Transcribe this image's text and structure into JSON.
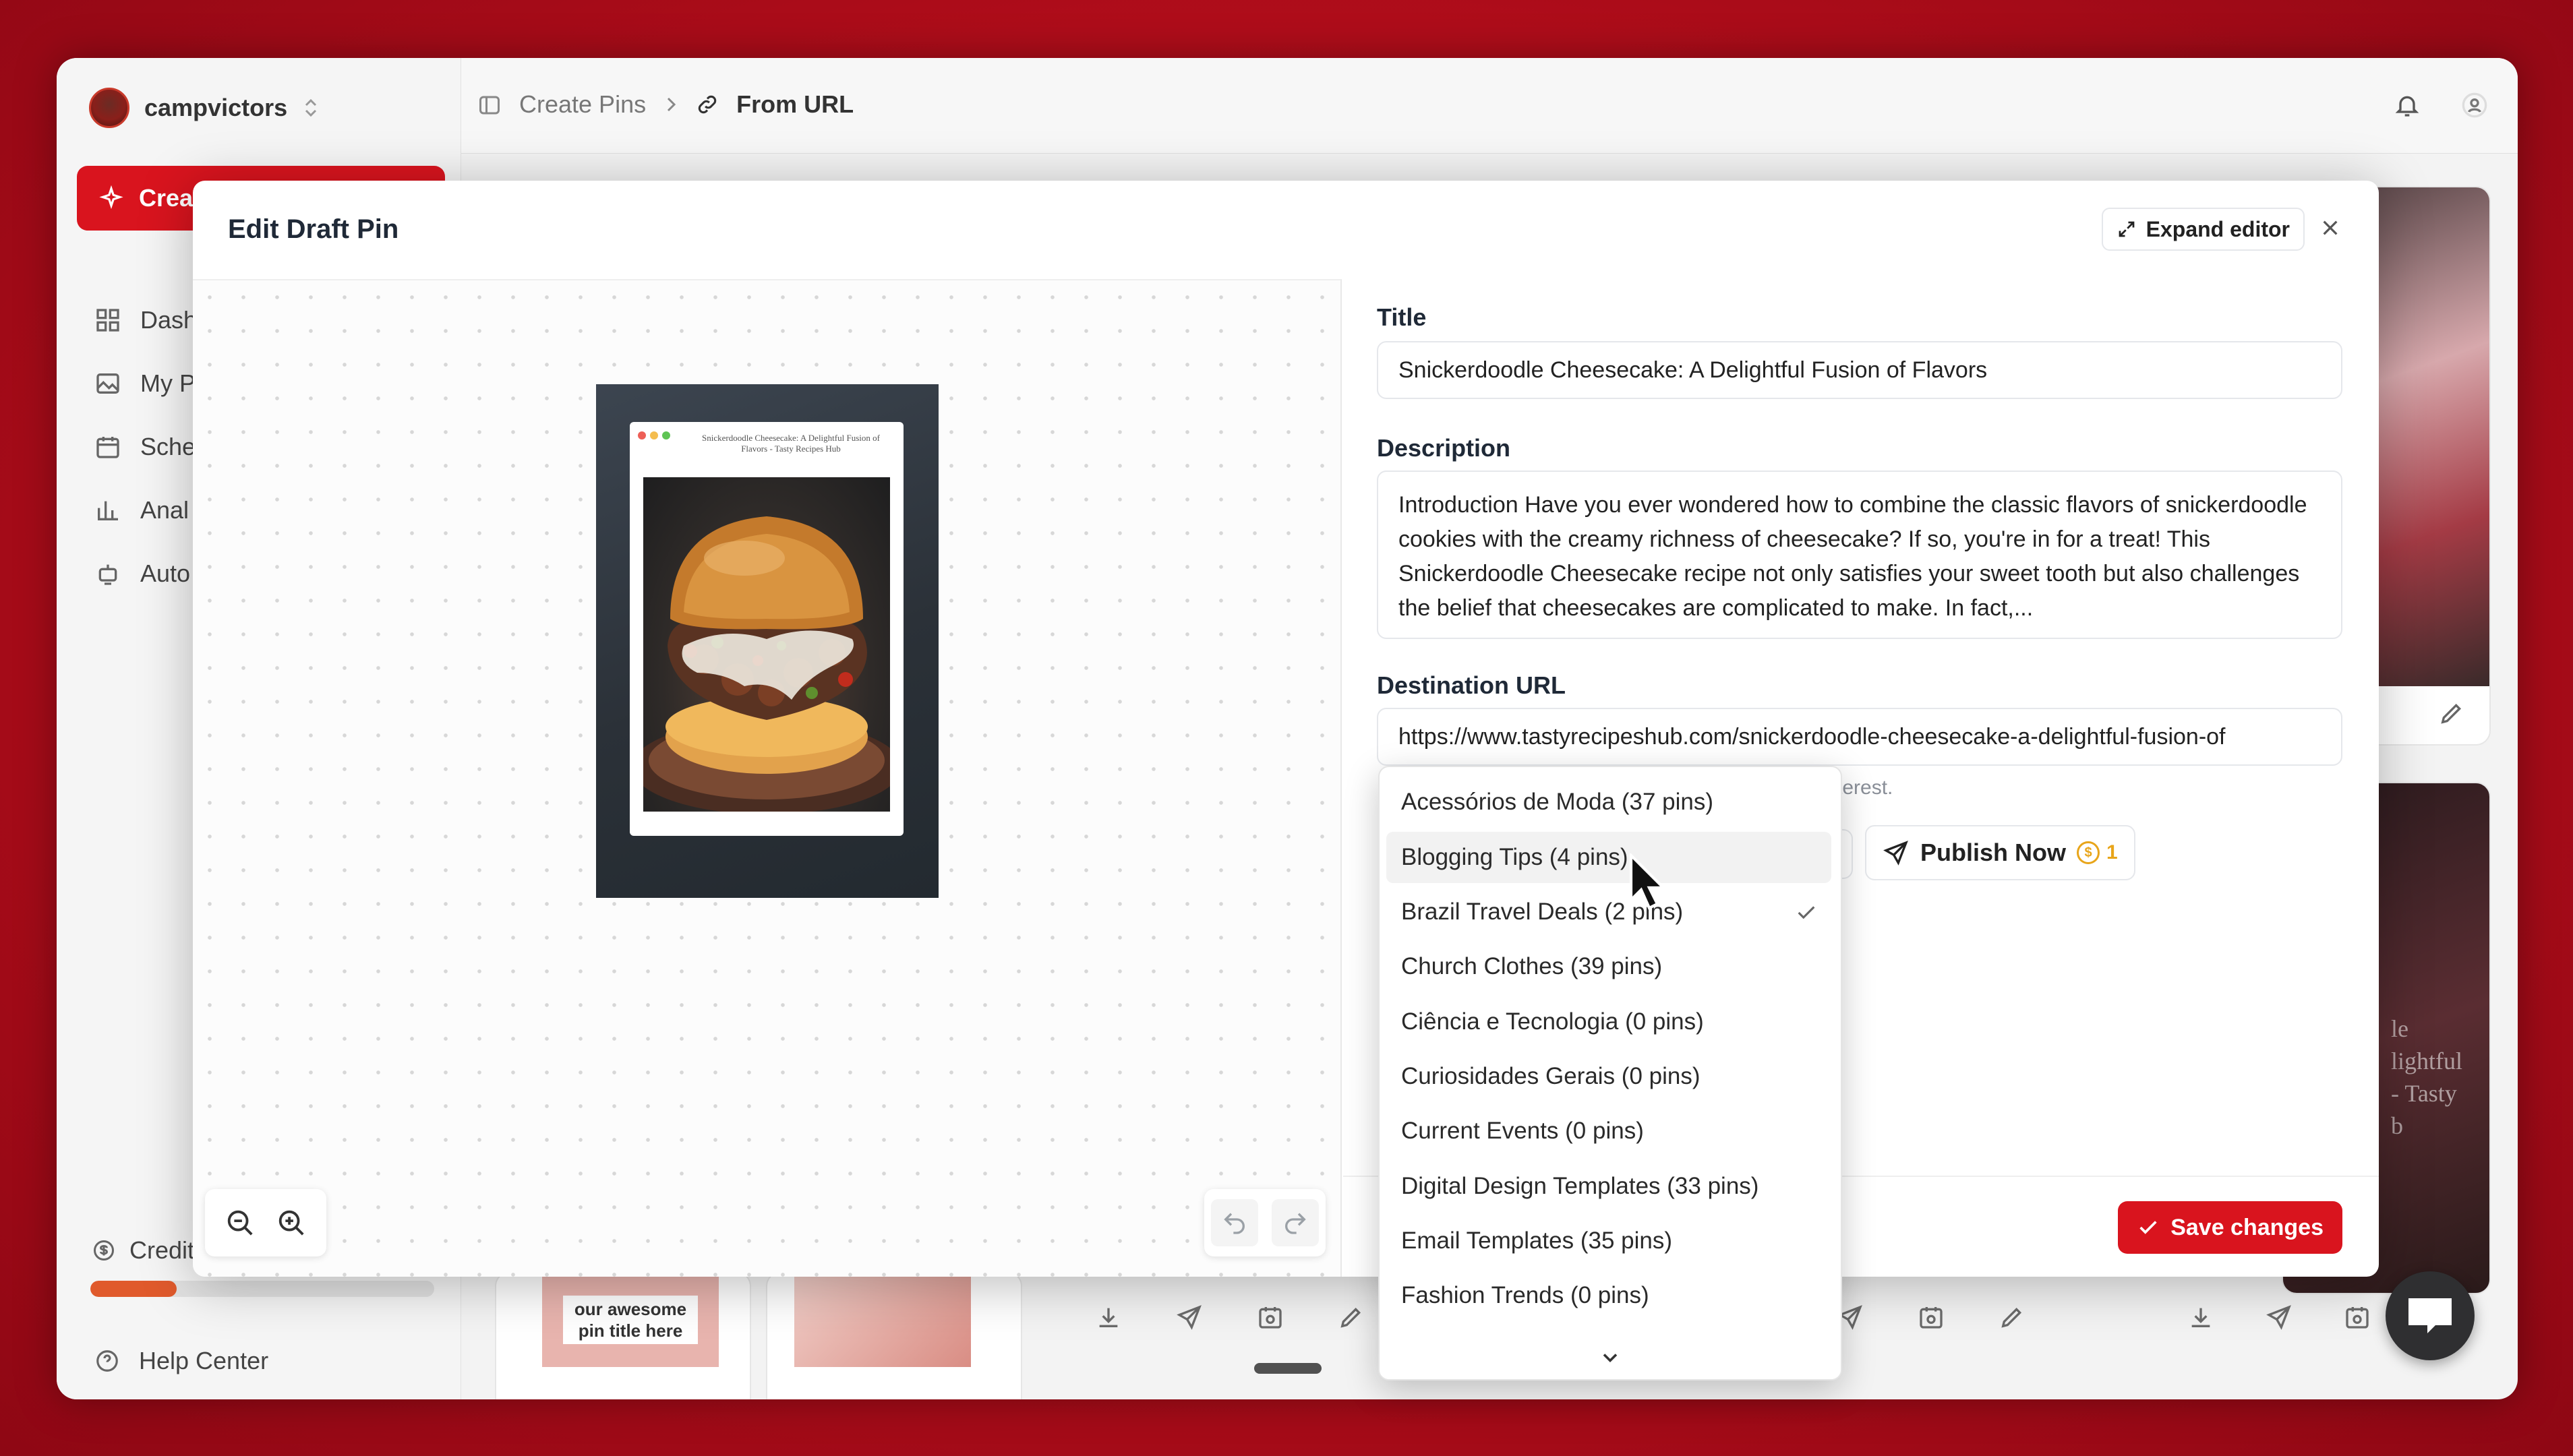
{
  "account": {
    "name": "campvictors"
  },
  "sidebar": {
    "create_label": "Crea",
    "items": [
      {
        "label": "Dash",
        "icon": "dashboard-icon"
      },
      {
        "label": "My P",
        "icon": "image-icon"
      },
      {
        "label": "Sche",
        "icon": "calendar-icon"
      },
      {
        "label": "Anal",
        "icon": "chart-icon"
      },
      {
        "label": "Auto",
        "icon": "robot-icon"
      }
    ],
    "credits_label": "Credit",
    "credits_progress": 0.25,
    "help_label": "Help Center"
  },
  "breadcrumb": {
    "parent": "Create Pins",
    "current": "From URL"
  },
  "background_cards": {
    "thumb_text": "our awesome pin title here",
    "overlay_text": [
      "le",
      "lightful",
      "- Tasty",
      "b"
    ]
  },
  "modal": {
    "title": "Edit Draft Pin",
    "expand_label": "Expand editor",
    "pin_preview": {
      "header_text": "Snickerdoodle Cheesecake: A Delightful Fusion of Flavors - Tasty Recipes Hub"
    },
    "form": {
      "title_label": "Title",
      "title_value": "Snickerdoodle Cheesecake: A Delightful Fusion of Flavors",
      "description_label": "Description",
      "description_value": "Introduction Have you ever wondered how to combine the classic flavors of snickerdoodle cookies with the creamy richness of cheesecake? If so, you're in for a treat! This Snickerdoodle Cheesecake recipe not only satisfies your sweet tooth but also challenges the belief that cheesecakes are complicated to make. In fact,...",
      "url_label": "Destination URL",
      "url_value": "https://www.tastyrecipeshub.com/snickerdoodle-cheesecake-a-delightful-fusion-of",
      "helper_text": "terest."
    },
    "publish_label": "Publish Now",
    "publish_cost": "1",
    "save_label": "Save changes"
  },
  "board_dropdown": {
    "options": [
      {
        "label": "Acessórios de Moda (37 pins)",
        "selected": false,
        "hovered": false
      },
      {
        "label": "Blogging Tips (4 pins)",
        "selected": false,
        "hovered": true
      },
      {
        "label": "Brazil Travel Deals (2 pins)",
        "selected": true,
        "hovered": false
      },
      {
        "label": "Church Clothes (39 pins)",
        "selected": false,
        "hovered": false
      },
      {
        "label": "Ciência e Tecnologia (0 pins)",
        "selected": false,
        "hovered": false
      },
      {
        "label": "Curiosidades Gerais (0 pins)",
        "selected": false,
        "hovered": false
      },
      {
        "label": "Current Events (0 pins)",
        "selected": false,
        "hovered": false
      },
      {
        "label": "Digital Design Templates (33 pins)",
        "selected": false,
        "hovered": false
      },
      {
        "label": "Email Templates (35 pins)",
        "selected": false,
        "hovered": false
      },
      {
        "label": "Fashion Trends (0 pins)",
        "selected": false,
        "hovered": false
      }
    ]
  },
  "colors": {
    "brand_red": "#d9141e",
    "coin": "#e8a51a"
  }
}
